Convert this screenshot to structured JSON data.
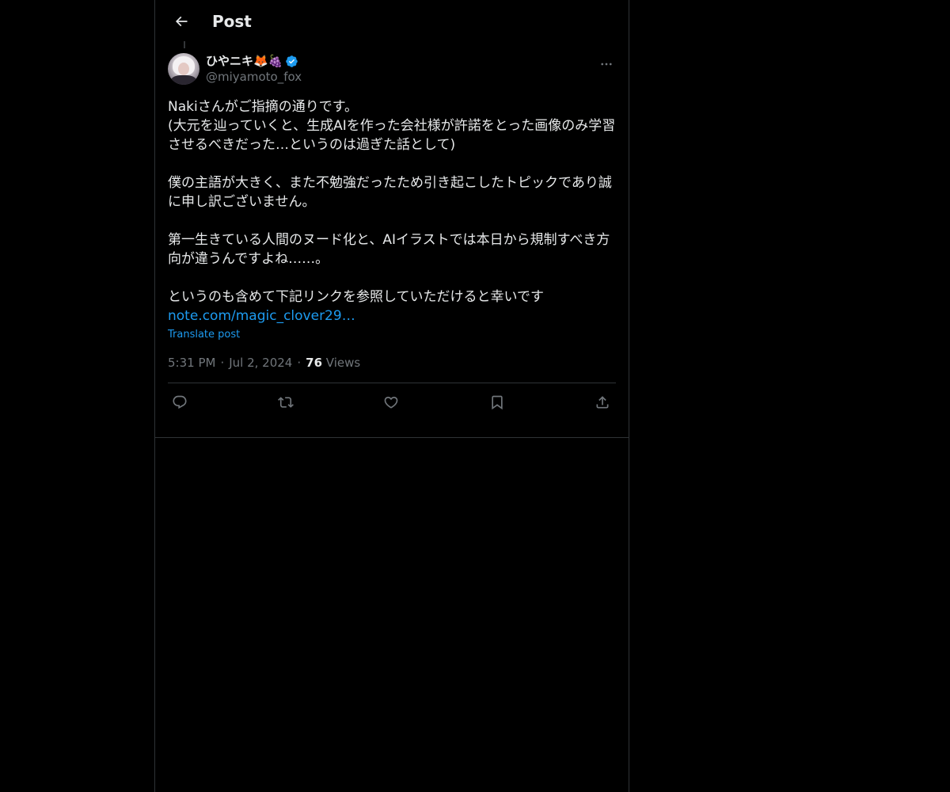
{
  "header": {
    "title": "Post"
  },
  "author": {
    "display_name": "ひやニキ🦊🍇",
    "handle": "@miyamoto_fox",
    "verified": true
  },
  "post": {
    "text": "Nakiさんがご指摘の通りです。\n(大元を辿っていくと、生成AIを作った会社様が許諾をとった画像のみ学習させるべきだった…というのは過ぎた話として)\n\n僕の主語が大きく、また不勉強だったため引き起こしたトピックであり誠に申し訳ございません。\n\n第一生きている人間のヌード化と、AIイラストでは本日から規制すべき方向が違うんですよね……。\n\nというのも含めて下記リンクを参照していただけると幸いです\n",
    "link_text": "note.com/magic_clover29…",
    "translate_label": "Translate post",
    "time": "5:31 PM",
    "date": "Jul 2, 2024",
    "views_count": "76",
    "views_label": "Views"
  },
  "actions": {
    "reply_icon": "reply-icon",
    "repost_icon": "repost-icon",
    "like_icon": "heart-icon",
    "bookmark_icon": "bookmark-icon",
    "share_icon": "share-icon"
  },
  "colors": {
    "background": "#000000",
    "text": "#e7e9ea",
    "muted": "#71767b",
    "accent": "#1d9bf0",
    "border": "#2f3336"
  }
}
